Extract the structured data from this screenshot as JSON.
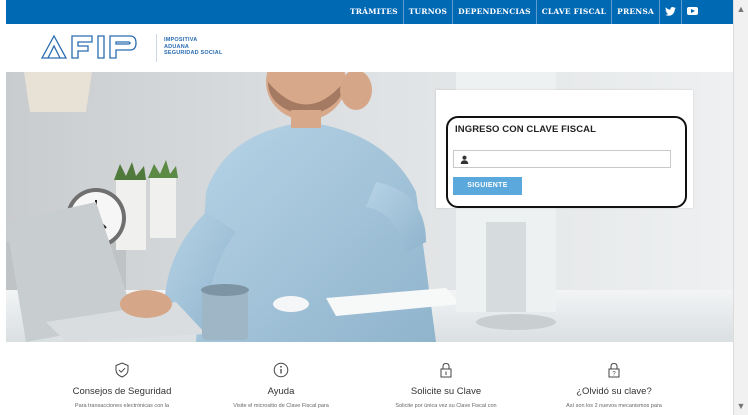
{
  "nav": {
    "links": [
      "TRÁMITES",
      "TURNOS",
      "DEPENDENCIAS",
      "CLAVE FISCAL",
      "PRENSA"
    ],
    "social": [
      "twitter-icon",
      "youtube-icon"
    ]
  },
  "header": {
    "logo_text": "AFIP",
    "lines": [
      "IMPOSITIVA",
      "ADUANA",
      "SEGURIDAD SOCIAL"
    ]
  },
  "login": {
    "title": "INGRESO CON CLAVE FISCAL",
    "input_value": "",
    "button_label": "SIGUIENTE"
  },
  "features": [
    {
      "icon": "shield-check-icon",
      "title": "Consejos de Seguridad",
      "desc": "Para transacciones electrónicas con la"
    },
    {
      "icon": "info-icon",
      "title": "Ayuda",
      "desc": "Visite el micrositio de Clave Fiscal para"
    },
    {
      "icon": "lock-info-icon",
      "title": "Solicite su Clave",
      "desc": "Solicite por única vez su Clave Fiscal con"
    },
    {
      "icon": "lock-question-icon",
      "title": "¿Olvidó su clave?",
      "desc": "Así son los 2 nuevos mecanismos para"
    }
  ],
  "colors": {
    "nav_bg": "#0069b4",
    "button_bg": "#5aa8dc",
    "brand": "#2a6cb0"
  }
}
